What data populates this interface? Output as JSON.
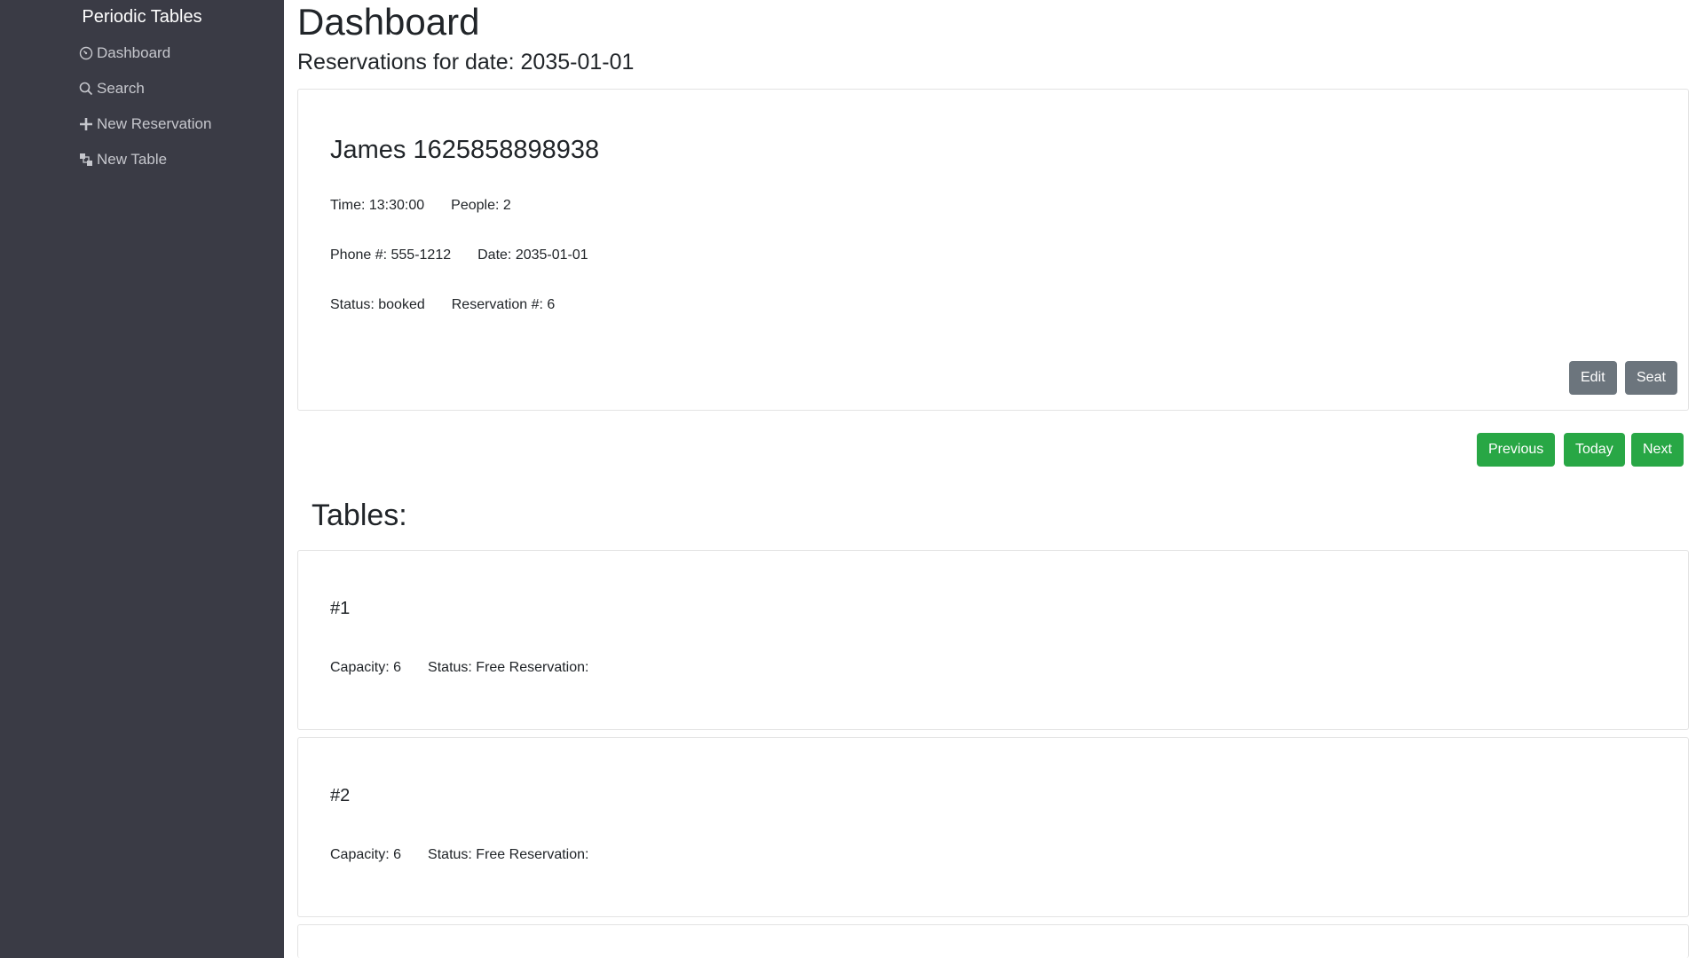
{
  "sidebar": {
    "brand": "Periodic Tables",
    "items": [
      {
        "label": "Dashboard",
        "icon": "dashboard-icon"
      },
      {
        "label": "Search",
        "icon": "search-icon"
      },
      {
        "label": "New Reservation",
        "icon": "plus-icon"
      },
      {
        "label": "New Table",
        "icon": "new-table-icon"
      }
    ]
  },
  "header": {
    "title": "Dashboard",
    "subtitle": "Reservations for date: 2035-01-01"
  },
  "reservation": {
    "name": "James 1625858898938",
    "time": "Time: 13:30:00",
    "people": "People: 2",
    "phone": "Phone #: 555-1212",
    "date": "Date: 2035-01-01",
    "status": "Status: booked",
    "number": "Reservation #: 6",
    "edit_label": "Edit",
    "seat_label": "Seat"
  },
  "date_nav": {
    "previous_label": "Previous",
    "today_label": "Today",
    "next_label": "Next"
  },
  "tables_section": {
    "title": "Tables:",
    "tables": [
      {
        "name": "#1",
        "capacity": "Capacity: 6",
        "status": "Status: Free Reservation:"
      },
      {
        "name": "#2",
        "capacity": "Capacity: 6",
        "status": "Status: Free Reservation:"
      }
    ]
  },
  "colors": {
    "sidebar_bg": "#3a3b45",
    "green_button": "#28a745",
    "gray_button": "#6c757d"
  }
}
